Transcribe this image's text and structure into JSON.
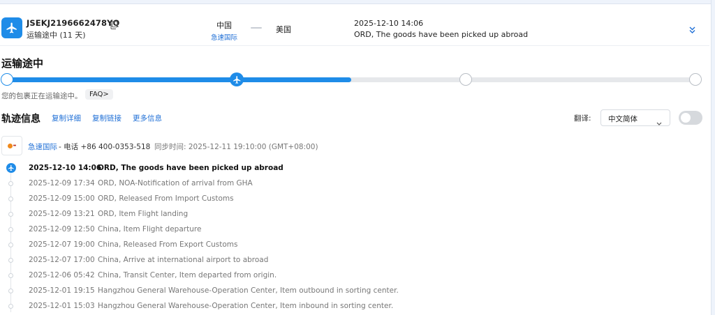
{
  "header": {
    "tracking_number": "JSEKJ2196662478YQ",
    "status": "运输途中 (11 天)",
    "origin_country": "中国",
    "origin_carrier": "急速国际",
    "destination_country": "美国",
    "latest_time": "2025-12-10 14:06",
    "latest_event": "ORD, The goods have been picked up abroad"
  },
  "progress": {
    "title": "运输途中",
    "note": "您的包裹正在运输途中。",
    "faq_label": "FAQ>",
    "level_percent": 50,
    "step_count": 4,
    "current_step": 2
  },
  "tracking_info": {
    "title": "轨迹信息",
    "copy_details": "复制详细",
    "copy_link": "复制链接",
    "more_info": "更多信息",
    "translate_label": "翻译:",
    "language_value": "中文简体",
    "translate_enabled": false
  },
  "carrier": {
    "name": "急速国际",
    "phone": "- 电话 +86 400-0353-518",
    "sync_time": "同步时间: 2025-12-11 19:10:00 (GMT+08:00)"
  },
  "events": [
    {
      "time": "2025-12-10 14:06",
      "desc": "ORD, The goods have been picked up abroad"
    },
    {
      "time": "2025-12-09 17:34",
      "desc": "ORD, NOA-Notification of arrival from GHA"
    },
    {
      "time": "2025-12-09 15:00",
      "desc": "ORD, Released From Import Customs"
    },
    {
      "time": "2025-12-09 13:21",
      "desc": "ORD, Item Flight landing"
    },
    {
      "time": "2025-12-09 12:50",
      "desc": "China, Item Flight departure"
    },
    {
      "time": "2025-12-07 19:00",
      "desc": "China, Released From Export Customs"
    },
    {
      "time": "2025-12-07 17:00",
      "desc": "China, Arrive at international airport to abroad"
    },
    {
      "time": "2025-12-06 05:42",
      "desc": "China, Transit Center, Item departed from origin."
    },
    {
      "time": "2025-12-01 19:15",
      "desc": "Hangzhou General Warehouse-Operation Center, Item outbound in sorting center."
    },
    {
      "time": "2025-12-01 15:03",
      "desc": "Hangzhou General Warehouse-Operation Center, Item inbound in sorting center."
    }
  ],
  "colors": {
    "accent": "#1f8ce8",
    "link": "#1f6fd6",
    "muted": "#777777"
  },
  "icons": {
    "badge": "airplane-icon",
    "copy": "copy-icon",
    "expand": "double-chevron-down-icon",
    "select": "chevron-down-icon"
  }
}
